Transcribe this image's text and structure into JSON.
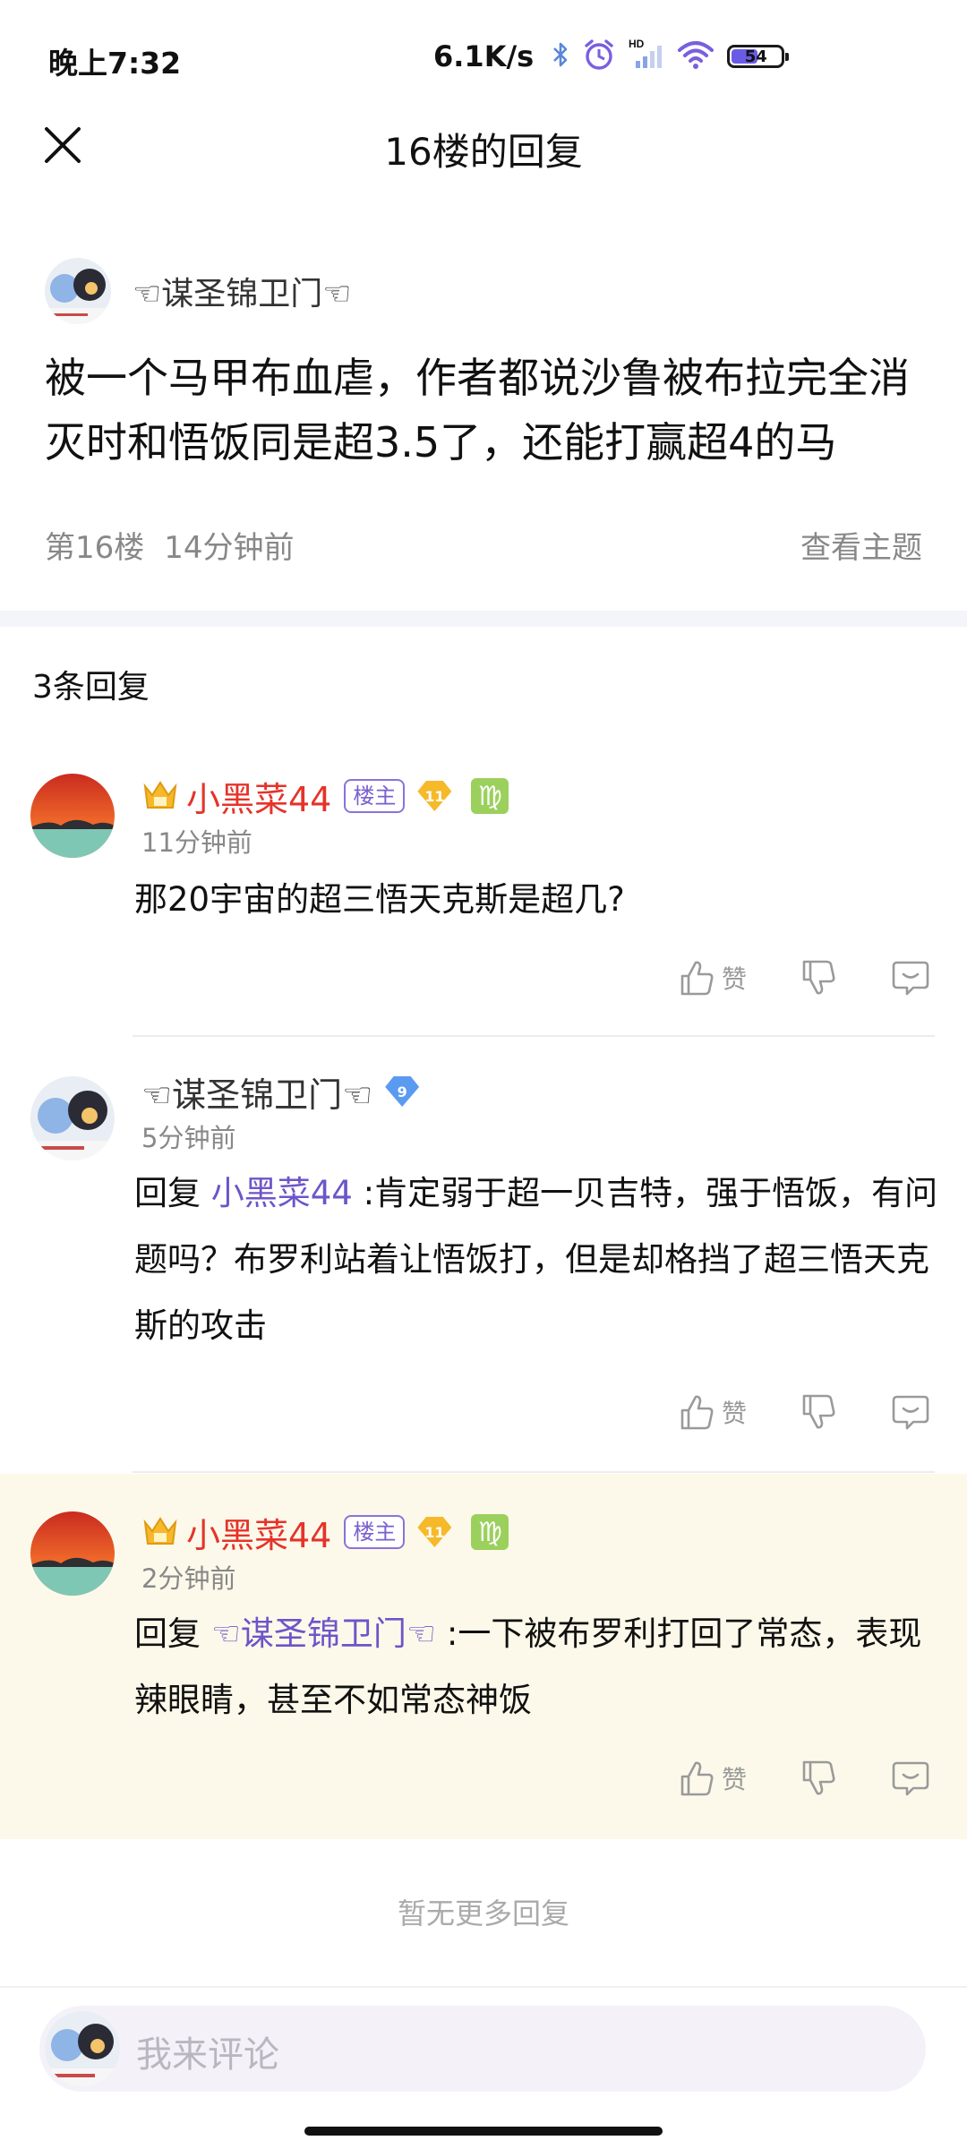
{
  "status_bar": {
    "time": "晚上7:32",
    "net_speed": "6.1K/s",
    "battery_level": "54",
    "battery_fraction": 0.54,
    "icons": [
      "bluetooth-icon",
      "alarm-icon",
      "hd-signal-icon",
      "wifi-icon",
      "battery-icon"
    ]
  },
  "header": {
    "title": "16楼的回复",
    "close_icon": "close-icon"
  },
  "post": {
    "username": "☜谋圣锦卫门☜",
    "body": "被一个马甲布血虐，作者都说沙鲁被布拉完全消灭时和悟饭同是超3.5了，还能打赢超4的马",
    "floor": "第16楼",
    "time": "14分钟前",
    "view_topic": "查看主题"
  },
  "reply_count": "3条回复",
  "replies": [
    {
      "username": "小黑菜44",
      "host_badge": "楼主",
      "level": "11",
      "zodiac": "♍",
      "time": "11分钟前",
      "text": "那20宇宙的超三悟天克斯是超几?",
      "like_label": "赞"
    },
    {
      "username": "☜谋圣锦卫门☜",
      "level": "9",
      "time": "5分钟前",
      "reply_prefix": "回复",
      "mention": "小黑菜44",
      "text": " :肯定弱于超一贝吉特，强于悟饭，有问题吗？布罗利站着让悟饭打，但是却格挡了超三悟天克斯的攻击",
      "like_label": "赞"
    },
    {
      "username": "小黑菜44",
      "host_badge": "楼主",
      "level": "11",
      "zodiac": "♍",
      "time": "2分钟前",
      "reply_prefix": "回复",
      "mention": "☜谋圣锦卫门☜",
      "text": " :一下被布罗利打回了常态，表现辣眼睛，甚至不如常态神饭",
      "like_label": "赞"
    }
  ],
  "no_more": "暂无更多回复",
  "comment_input": {
    "placeholder": "我来评论"
  },
  "colors": {
    "host_name": "#e5332a",
    "mention": "#6d55c9",
    "highlight_bg": "#fdf9ea",
    "accent": "#8a73d9"
  }
}
